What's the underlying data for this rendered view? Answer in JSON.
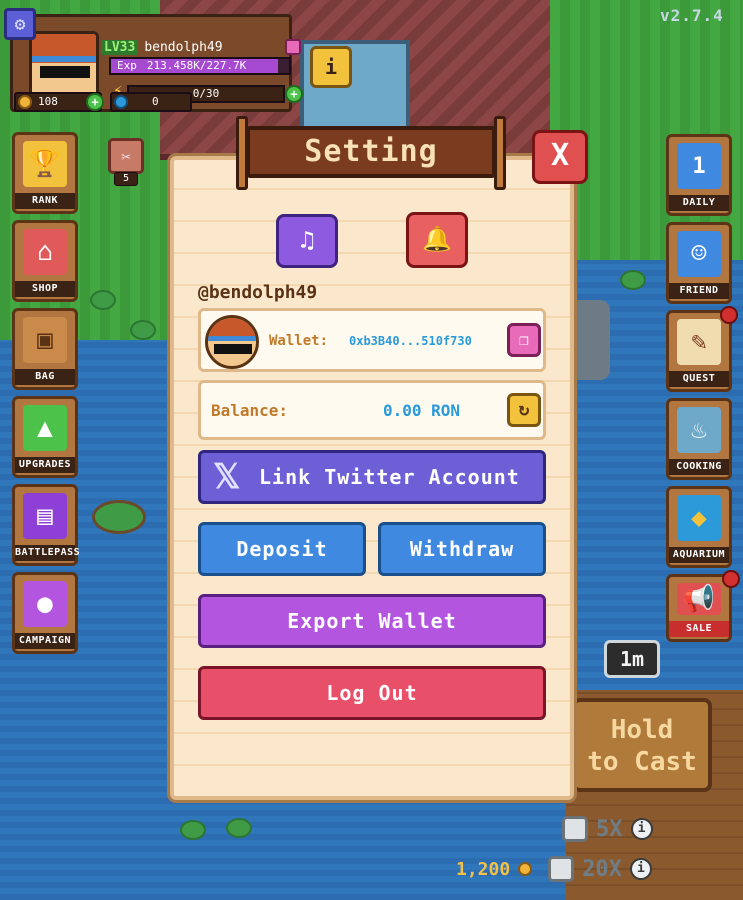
{
  "version": "v2.7.4",
  "player": {
    "level": "LV33",
    "name": "bendolph49",
    "exp_label": "Exp",
    "exp_value": "213.458K/227.7K",
    "exp_progress": 0.937,
    "energy": "0/30",
    "coins": "108",
    "gems": "0"
  },
  "quest_mini": {
    "count": "5"
  },
  "info_button": {
    "label": "i"
  },
  "left_menu": [
    {
      "label": "RANK",
      "icon": "trophy-icon"
    },
    {
      "label": "SHOP",
      "icon": "shop-icon"
    },
    {
      "label": "BAG",
      "icon": "backpack-icon"
    },
    {
      "label": "UPGRADES",
      "icon": "arrow-up-icon"
    },
    {
      "label": "BATTLEPASS",
      "icon": "ticket-icon"
    },
    {
      "label": "CAMPAIGN",
      "icon": "globe-icon"
    }
  ],
  "right_menu": [
    {
      "label": "DAILY",
      "icon": "calendar-icon",
      "day": "1"
    },
    {
      "label": "FRIEND",
      "icon": "friend-icon"
    },
    {
      "label": "QUEST",
      "icon": "scroll-icon"
    },
    {
      "label": "COOKING",
      "icon": "pot-icon"
    },
    {
      "label": "AQUARIUM",
      "icon": "aquarium-icon"
    },
    {
      "label": "SALE",
      "icon": "megaphone-icon"
    }
  ],
  "timer": "1m",
  "cast_button": {
    "line1": "Hold",
    "line2": "to Cast"
  },
  "multipliers": [
    {
      "label": "5X"
    },
    {
      "label": "20X",
      "cost": "1,200"
    }
  ],
  "settings": {
    "title": "Setting",
    "close_label": "X",
    "username": "@bendolph49",
    "wallet_label": "Wallet:",
    "wallet_address": "0xb3B40...510f730",
    "balance_label": "Balance:",
    "balance_value": "0.00 RON",
    "buttons": {
      "twitter": "Link Twitter Account",
      "deposit": "Deposit",
      "withdraw": "Withdraw",
      "export": "Export Wallet",
      "logout": "Log Out"
    }
  },
  "colors": {
    "panel_bg": "#fbe8cc",
    "title_plank": "#7a3b1f",
    "twitter": "#6d5fd6",
    "deposit": "#3f8ae0",
    "export": "#b455e0",
    "logout": "#e8506a",
    "close": "#e05050"
  }
}
